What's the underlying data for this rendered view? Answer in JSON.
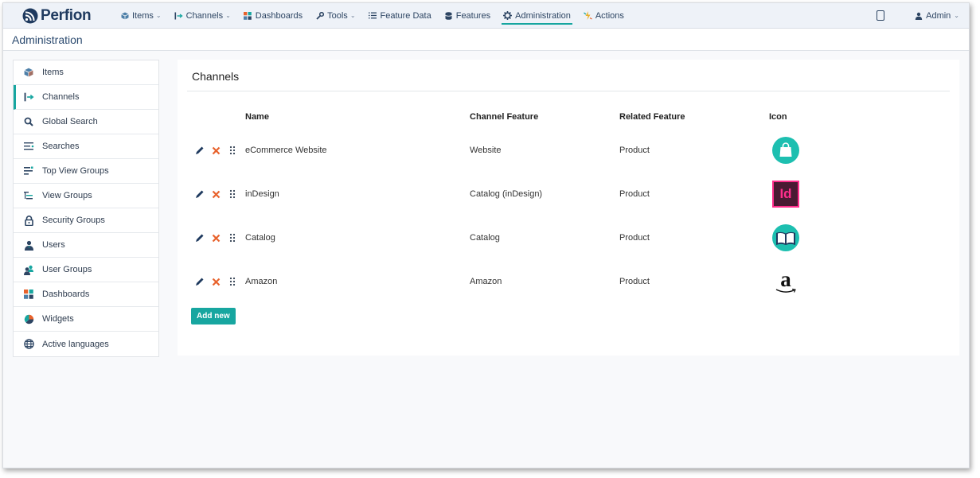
{
  "app": {
    "brand": "Perfion",
    "colors": {
      "accent": "#17a6a0",
      "nav_text": "#2d4563",
      "delete": "#e8622c"
    }
  },
  "nav": {
    "items": [
      {
        "label": "Items",
        "icon": "cube-icon",
        "dropdown": true
      },
      {
        "label": "Channels",
        "icon": "channel-arrow-icon",
        "dropdown": true
      },
      {
        "label": "Dashboards",
        "icon": "dashboard-grid-icon",
        "dropdown": false
      },
      {
        "label": "Tools",
        "icon": "wrench-icon",
        "dropdown": true
      },
      {
        "label": "Feature Data",
        "icon": "list-icon",
        "dropdown": false
      },
      {
        "label": "Features",
        "icon": "database-icon",
        "dropdown": false
      },
      {
        "label": "Administration",
        "icon": "gear-icon",
        "dropdown": false,
        "active": true
      },
      {
        "label": "Actions",
        "icon": "lightning-icon",
        "dropdown": false
      }
    ],
    "user": "Admin"
  },
  "page": {
    "title": "Administration"
  },
  "sidebar": {
    "items": [
      {
        "label": "Items",
        "icon": "cube-icon"
      },
      {
        "label": "Channels",
        "icon": "channel-arrow-icon",
        "active": true
      },
      {
        "label": "Global Search",
        "icon": "search-icon"
      },
      {
        "label": "Searches",
        "icon": "searches-list-icon"
      },
      {
        "label": "Top View Groups",
        "icon": "top-view-groups-icon"
      },
      {
        "label": "View Groups",
        "icon": "view-groups-icon"
      },
      {
        "label": "Security Groups",
        "icon": "lock-icon"
      },
      {
        "label": "Users",
        "icon": "user-icon"
      },
      {
        "label": "User Groups",
        "icon": "user-group-icon"
      },
      {
        "label": "Dashboards",
        "icon": "dashboard-grid-icon"
      },
      {
        "label": "Widgets",
        "icon": "pie-icon"
      },
      {
        "label": "Active languages",
        "icon": "globe-icon"
      }
    ]
  },
  "channels": {
    "title": "Channels",
    "columns": {
      "name": "Name",
      "channel_feature": "Channel Feature",
      "related_feature": "Related Feature",
      "icon": "Icon"
    },
    "rows": [
      {
        "name": "eCommerce Website",
        "channel_feature": "Website",
        "related_feature": "Product",
        "icon": "shopping-bag-icon"
      },
      {
        "name": "inDesign",
        "channel_feature": "Catalog (inDesign)",
        "related_feature": "Product",
        "icon": "indesign-icon"
      },
      {
        "name": "Catalog",
        "channel_feature": "Catalog",
        "related_feature": "Product",
        "icon": "open-book-icon"
      },
      {
        "name": "Amazon",
        "channel_feature": "Amazon",
        "related_feature": "Product",
        "icon": "amazon-icon"
      }
    ],
    "add_label": "Add new",
    "icon_text": {
      "indesign": "Id",
      "amazon": "a"
    }
  }
}
